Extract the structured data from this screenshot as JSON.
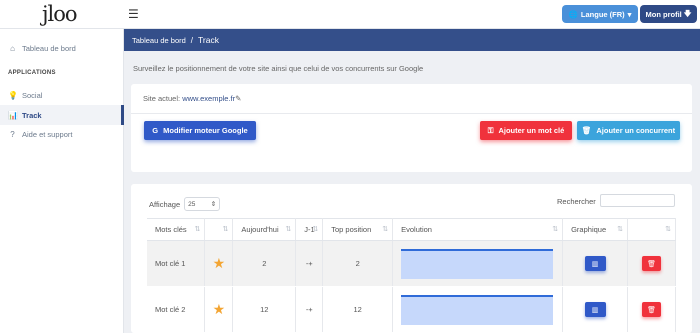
{
  "app": {
    "logo": "jloo"
  },
  "topbar": {
    "language_label": "Langue (FR)",
    "profile_label": "Mon profil"
  },
  "sidebar": {
    "dashboard": "Tableau de bord",
    "section_heading": "APPLICATIONS",
    "social": "Social",
    "track": "Track",
    "help": "Aide et support"
  },
  "breadcrumb": {
    "home": "Tableau de bord",
    "separator": "/",
    "current": "Track"
  },
  "intro_text": "Surveillez le positionnement de votre site ainsi que celui de vos concurrents sur Google",
  "site": {
    "label": "Site actuel:",
    "url": "www.exemple.fr"
  },
  "actions": {
    "change_engine": "Modifier moteur Google",
    "add_keyword": "Ajouter un mot clé",
    "add_competitor": "Ajouter un concurrent"
  },
  "table_controls": {
    "show_label": "Affichage",
    "page_size": "25",
    "search_label": "Rechercher",
    "search_value": ""
  },
  "table": {
    "headers": [
      "Mots clés",
      "",
      "Aujourd'hui",
      "J-1",
      "Top position",
      "Evolution",
      "Graphique",
      ""
    ],
    "rows": [
      {
        "keyword": "Mot clé 1",
        "today": "2",
        "prev": "-+",
        "top": "2"
      },
      {
        "keyword": "Mot clé 2",
        "today": "12",
        "prev": "-+",
        "top": "12"
      }
    ]
  },
  "colors": {
    "primary": "#3059c8",
    "danger": "#f0323c",
    "info": "#3ba4dc",
    "header": "#344f8a",
    "star": "#f3a533"
  }
}
